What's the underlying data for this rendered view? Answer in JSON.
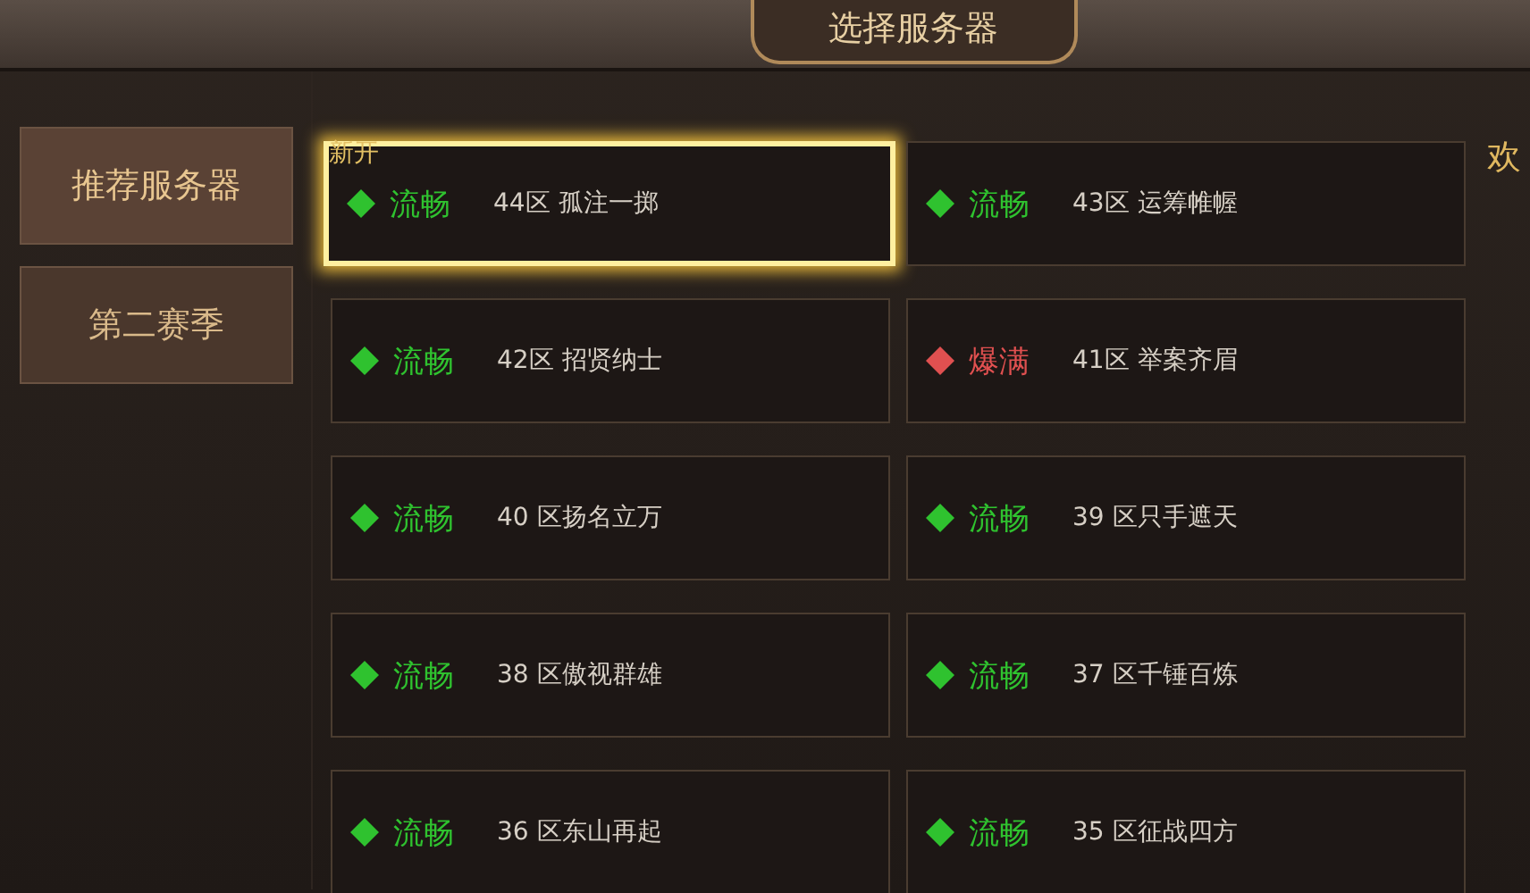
{
  "header": {
    "title": "选择服务器"
  },
  "sidebar": {
    "items": [
      {
        "label": "推荐服务器",
        "selected": true
      },
      {
        "label": "第二赛季",
        "selected": false
      }
    ]
  },
  "servers": [
    {
      "status": "流畅",
      "kind": "smooth",
      "name": "44区 孤注一掷",
      "badge": "新开",
      "selected": true
    },
    {
      "status": "流畅",
      "kind": "smooth",
      "name": "43区 运筹帷幄",
      "selected": false
    },
    {
      "status": "流畅",
      "kind": "smooth",
      "name": "42区 招贤纳士",
      "selected": false
    },
    {
      "status": "爆满",
      "kind": "full",
      "name": "41区 举案齐眉",
      "selected": false
    },
    {
      "status": "流畅",
      "kind": "smooth",
      "name": "40 区扬名立万",
      "selected": false
    },
    {
      "status": "流畅",
      "kind": "smooth",
      "name": "39 区只手遮天",
      "selected": false
    },
    {
      "status": "流畅",
      "kind": "smooth",
      "name": "38 区傲视群雄",
      "selected": false
    },
    {
      "status": "流畅",
      "kind": "smooth",
      "name": "37 区千锤百炼",
      "selected": false
    },
    {
      "status": "流畅",
      "kind": "smooth",
      "name": "36 区东山再起",
      "selected": false
    },
    {
      "status": "流畅",
      "kind": "smooth",
      "name": "35 区征战四方",
      "selected": false
    }
  ],
  "side_text": "欢"
}
